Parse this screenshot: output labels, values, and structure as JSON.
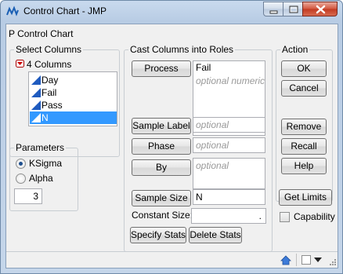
{
  "window": {
    "title": "Control Chart - JMP"
  },
  "heading": "P Control Chart",
  "select_columns": {
    "legend": "Select Columns",
    "count_label": "4 Columns",
    "columns": [
      "Day",
      "Fail",
      "Pass",
      "N"
    ],
    "selected": "N"
  },
  "parameters": {
    "legend": "Parameters",
    "options": [
      "KSigma",
      "Alpha"
    ],
    "selected": "KSigma",
    "value": "3"
  },
  "cast_columns": {
    "legend": "Cast Columns into Roles",
    "process_button": "Process",
    "process_value": "Fail",
    "process_placeholder": "optional numeric",
    "sample_label_button": "Sample Label",
    "sample_label_placeholder": "optional",
    "phase_button": "Phase",
    "phase_placeholder": "optional",
    "by_button": "By",
    "by_placeholder": "optional",
    "sample_size_button": "Sample Size",
    "sample_size_value": "N",
    "constant_size_label": "Constant Size:",
    "constant_size_value": ".",
    "specify_stats_button": "Specify Stats",
    "delete_stats_button": "Delete Stats"
  },
  "action": {
    "legend": "Action",
    "ok_button": "OK",
    "cancel_button": "Cancel",
    "remove_button": "Remove",
    "recall_button": "Recall",
    "help_button": "Help"
  },
  "get_limits_button": "Get Limits",
  "capability_label": "Capability",
  "colors": {
    "selection": "#3399ff",
    "title_gradient_top": "#c9daee",
    "close_button": "#c13a21"
  }
}
